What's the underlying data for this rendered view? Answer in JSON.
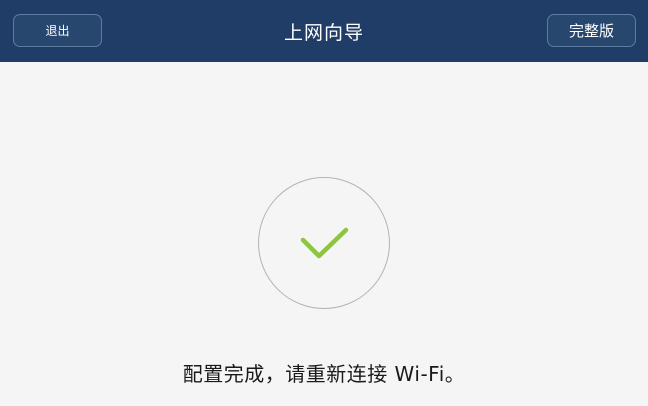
{
  "header": {
    "title": "上网向导",
    "exit_label": "退出",
    "full_version_label": "完整版"
  },
  "status": {
    "icon": "checkmark-icon",
    "message": "配置完成，请重新连接 Wi-Fi。"
  },
  "colors": {
    "header_background": "#1f3d66",
    "page_background": "#f5f5f5",
    "check_green": "#8cc63f",
    "circle_border": "#b3b3b3"
  }
}
